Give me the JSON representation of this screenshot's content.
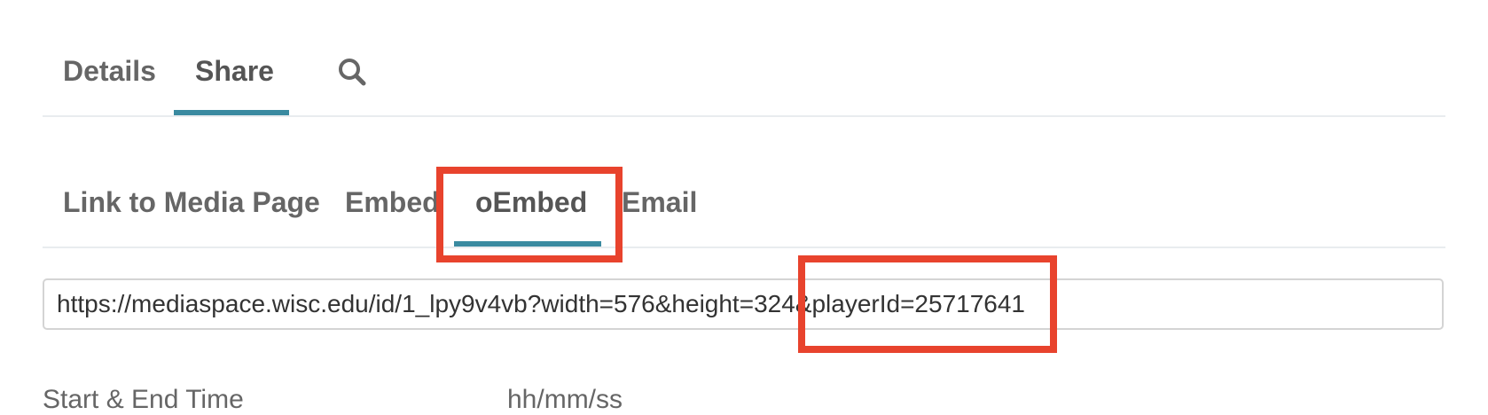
{
  "top_tabs": {
    "details": "Details",
    "share": "Share",
    "search_icon": "search-icon"
  },
  "share_tabs": {
    "link_to_media_page": "Link to Media Page",
    "embed": "Embed",
    "oembed": "oEmbed",
    "email": "Email"
  },
  "oembed_url": {
    "value": "https://mediaspace.wisc.edu/id/1_lpy9v4vb?width=576&height=324&playerId=25717641"
  },
  "start_end_time": {
    "label": "Start & End Time",
    "placeholder": "hh/mm/ss"
  },
  "colors": {
    "accent": "#3a8aa0",
    "highlight": "#e8432d"
  }
}
